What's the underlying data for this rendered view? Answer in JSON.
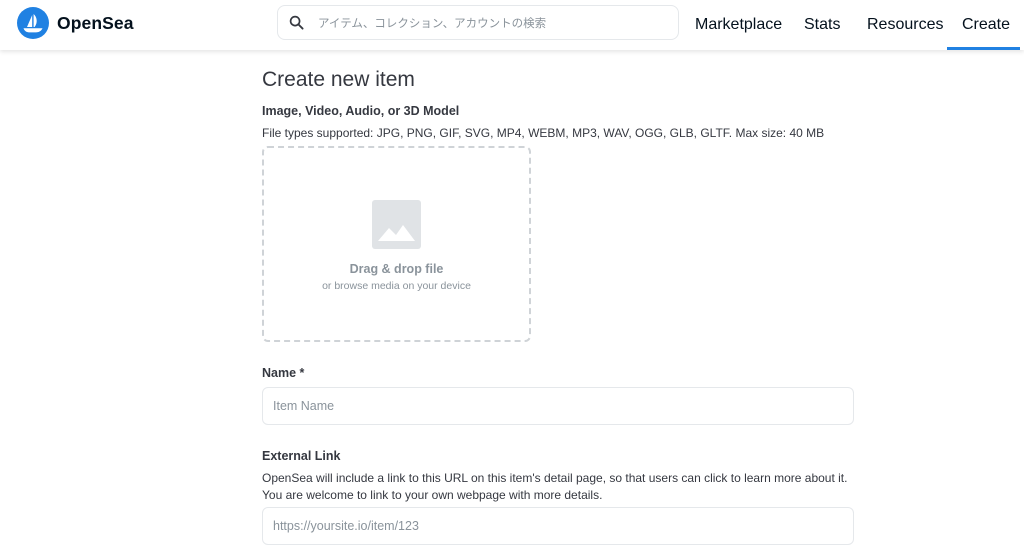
{
  "header": {
    "logo_text": "OpenSea",
    "search_placeholder": "アイテム、コレクション、アカウントの検索",
    "nav": [
      {
        "label": "Marketplace"
      },
      {
        "label": "Stats"
      },
      {
        "label": "Resources"
      },
      {
        "label": "Create",
        "active": true
      }
    ],
    "accent_color": "#2081e2"
  },
  "main": {
    "title": "Create new item",
    "media": {
      "label": "Image, Video, Audio, or 3D Model",
      "description": "File types supported: JPG, PNG, GIF, SVG, MP4, WEBM, MP3, WAV, OGG, GLB, GLTF. Max size: 40 MB",
      "drop_title": "Drag & drop file",
      "drop_subtitle": "or browse media on your device",
      "icon": "image-icon"
    },
    "name_field": {
      "label": "Name *",
      "placeholder": "Item Name",
      "value": ""
    },
    "external_link": {
      "label": "External Link",
      "description": "OpenSea will include a link to this URL on this item's detail page, so that users can click to learn more about it. You are welcome to link to your own webpage with more details.",
      "placeholder": "https://yoursite.io/item/123",
      "value": ""
    }
  }
}
